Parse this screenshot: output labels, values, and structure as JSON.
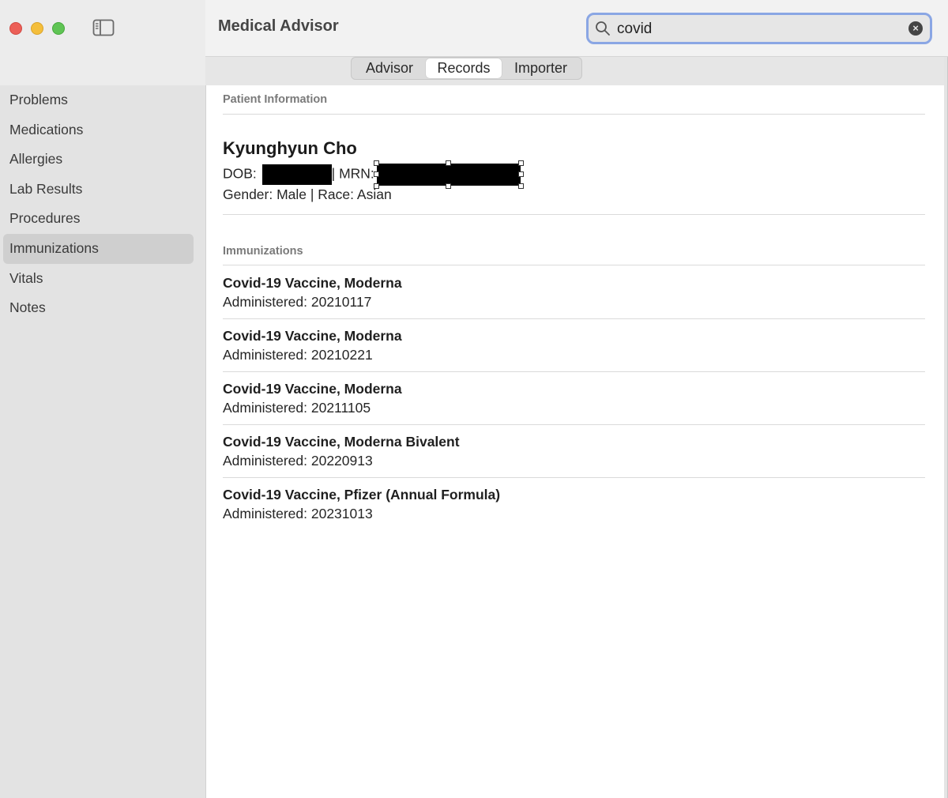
{
  "app": {
    "title": "Medical Advisor"
  },
  "search": {
    "value": "covid",
    "placeholder": ""
  },
  "tabs": [
    {
      "label": "Advisor",
      "selected": false
    },
    {
      "label": "Records",
      "selected": true
    },
    {
      "label": "Importer",
      "selected": false
    }
  ],
  "sidebar": {
    "items": [
      {
        "label": "Problems"
      },
      {
        "label": "Medications"
      },
      {
        "label": "Allergies"
      },
      {
        "label": "Lab Results"
      },
      {
        "label": "Procedures"
      },
      {
        "label": "Immunizations",
        "active": true
      },
      {
        "label": "Vitals"
      },
      {
        "label": "Notes"
      }
    ]
  },
  "patient": {
    "section_title": "Patient Information",
    "name": "Kyunghyun Cho",
    "dob_label": "DOB:",
    "mrn_label": "| MRN:",
    "gender_race": "Gender: Male | Race: Asian"
  },
  "immunizations": {
    "section_title": "Immunizations",
    "items": [
      {
        "name": "Covid-19 Vaccine, Moderna",
        "administered": "Administered: 20210117"
      },
      {
        "name": "Covid-19 Vaccine, Moderna",
        "administered": "Administered: 20210221"
      },
      {
        "name": "Covid-19 Vaccine, Moderna",
        "administered": "Administered: 20211105"
      },
      {
        "name": "Covid-19 Vaccine, Moderna Bivalent",
        "administered": "Administered: 20220913"
      },
      {
        "name": "Covid-19 Vaccine, Pfizer (Annual Formula)",
        "administered": "Administered: 20231013"
      }
    ]
  },
  "colors": {
    "accent": "#8aa6e4",
    "close": "#ec5f57",
    "minimize": "#f4be3b",
    "zoom": "#5fc454",
    "redaction": "#000000"
  }
}
